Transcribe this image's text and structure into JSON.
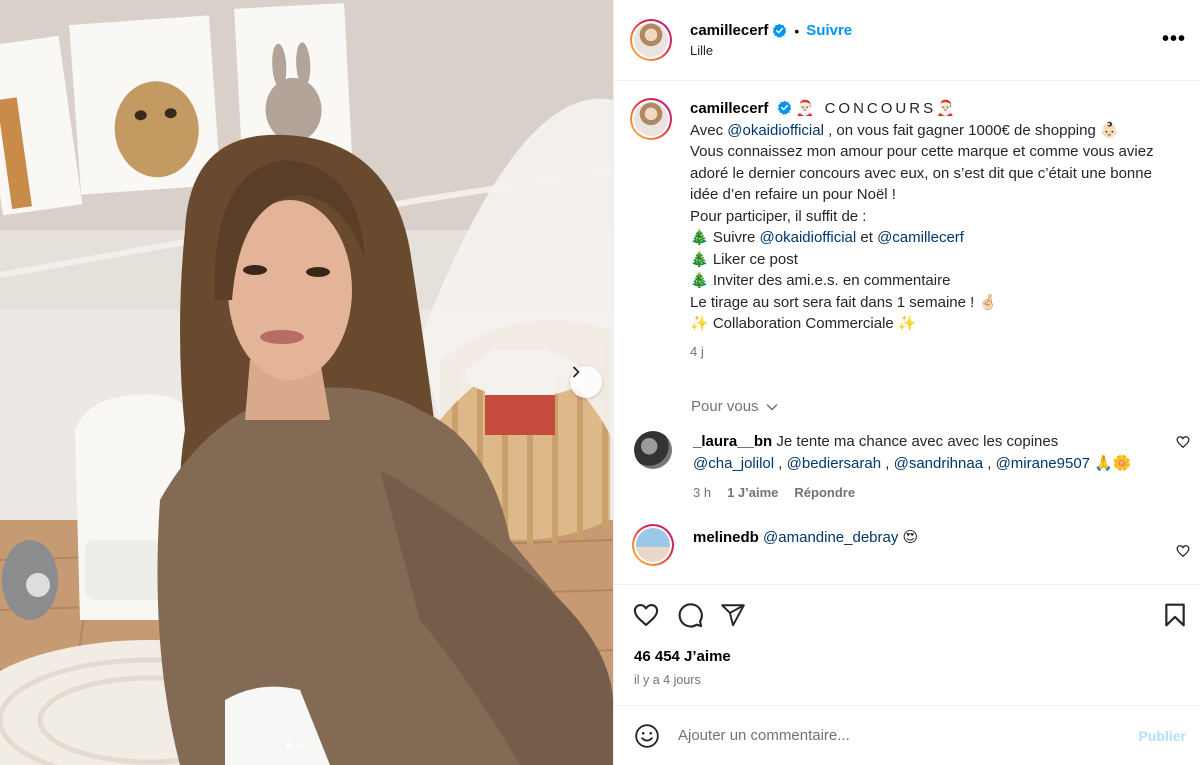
{
  "header": {
    "username": "camillecerf",
    "separator": "•",
    "follow_label": "Suivre",
    "location": "Lille",
    "more_label": "•••"
  },
  "caption": {
    "username": "camillecerf",
    "title": "🎅🏻 CONCOURS🎅🏻",
    "line1_prefix": "Avec ",
    "line1_mention": "@okaidiofficial",
    "line1_suffix": " , on vous fait gagner 1000€ de shopping 👶🏻",
    "line2": "Vous connaissez mon amour pour cette marque et comme vous aviez adoré le dernier concours avec eux, on s’est dit que c’était une bonne idée d’en refaire un pour Noël !",
    "line3": "Pour participer, il suffit de :",
    "step1_prefix": "🎄 Suivre ",
    "step1_mention1": "@okaidiofficial",
    "step1_and": " et ",
    "step1_mention2": "@camillecerf",
    "step2": "🎄 Liker ce post",
    "step3": "🎄  Inviter des ami.e.s. en commentaire",
    "line4": "Le tirage au sort sera fait dans 1 semaine ! 🤞🏻",
    "line5": "✨  Collaboration Commerciale  ✨",
    "time": "4 j"
  },
  "for_you": "Pour vous",
  "comments": [
    {
      "username": "_laura__bn",
      "text": " Je tente ma chance avec avec les copines ",
      "mentions": [
        "@cha_jolilol",
        "@bediersarah",
        "@sandrihnaa",
        "@mirane9507"
      ],
      "sep": " , ",
      "emoji_end": " 🙏🌼",
      "time": "3 h",
      "likes": "1 J’aime",
      "reply": "Répondre"
    },
    {
      "username": "melinedb",
      "mention": "@amandine_debray",
      "emoji": " 😍"
    }
  ],
  "stats": {
    "likes": "46 454 J’aime",
    "ago": "il y a 4 jours"
  },
  "add_comment": {
    "placeholder": "Ajouter un commentaire...",
    "publish": "Publier"
  },
  "colors": {
    "accent": "#0095f6",
    "mention": "#00376b",
    "muted": "#737373"
  },
  "carousel": {
    "current_index": 1,
    "total": 2
  }
}
